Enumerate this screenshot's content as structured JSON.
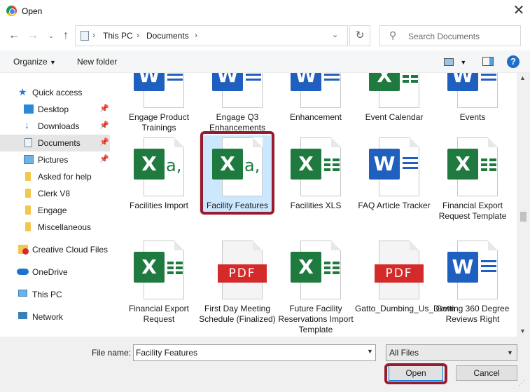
{
  "window": {
    "title": "Open"
  },
  "address": {
    "crumbs": [
      "This PC",
      "Documents"
    ]
  },
  "search": {
    "placeholder": "Search Documents"
  },
  "toolbar": {
    "organize_label": "Organize",
    "new_folder_label": "New folder"
  },
  "sidebar": {
    "items": [
      {
        "label": "Quick access",
        "icon": "star-icon",
        "pinned": false
      },
      {
        "label": "Desktop",
        "icon": "desktop-icon",
        "pinned": true
      },
      {
        "label": "Downloads",
        "icon": "download-icon",
        "pinned": true
      },
      {
        "label": "Documents",
        "icon": "documents-icon",
        "pinned": true,
        "selected": true
      },
      {
        "label": "Pictures",
        "icon": "pictures-icon",
        "pinned": true
      },
      {
        "label": "Asked for help",
        "icon": "folder-icon"
      },
      {
        "label": "Clerk V8",
        "icon": "folder-icon"
      },
      {
        "label": "Engage",
        "icon": "folder-icon"
      },
      {
        "label": "Miscellaneous",
        "icon": "folder-icon"
      },
      {
        "label": "Creative Cloud Files",
        "icon": "creative-cloud-icon"
      },
      {
        "label": "OneDrive",
        "icon": "cloud-icon"
      },
      {
        "label": "This PC",
        "icon": "computer-icon"
      },
      {
        "label": "Network",
        "icon": "network-icon"
      }
    ]
  },
  "files": [
    {
      "name": "Engage Product Trainings",
      "type": "word"
    },
    {
      "name": "Engage Q3 Enhancements",
      "type": "word"
    },
    {
      "name": "Enhancement",
      "type": "word"
    },
    {
      "name": "Event Calendar",
      "type": "excel"
    },
    {
      "name": "Events",
      "type": "word"
    },
    {
      "name": "Facilities Import",
      "type": "csv"
    },
    {
      "name": "Facility Features",
      "type": "csv",
      "selected": true
    },
    {
      "name": "Facilities XLS",
      "type": "excel"
    },
    {
      "name": "FAQ Article Tracker",
      "type": "word"
    },
    {
      "name": "Financial Export Request Template",
      "type": "excel"
    },
    {
      "name": "Financial Export Request",
      "type": "excel"
    },
    {
      "name": "First Day Meeting Schedule (Finalized)",
      "type": "pdf"
    },
    {
      "name": "Future Facility Reservations Import Template",
      "type": "excel"
    },
    {
      "name": "Gatto_Dumbing_Us_Down",
      "type": "pdf"
    },
    {
      "name": "Getting 360 Degree Reviews Right",
      "type": "word"
    }
  ],
  "icons": {
    "word_letter": "W",
    "excel_letter": "X",
    "csv_glyph": "a,",
    "pdf_label": "PDF"
  },
  "bottom": {
    "file_name_label": "File name:",
    "file_name_value": "Facility Features",
    "file_type": "All Files",
    "open_label": "Open",
    "cancel_label": "Cancel"
  },
  "colors": {
    "highlight": "#9b1b2e",
    "selection": "#cce8ff",
    "excel": "#1f7a3f",
    "word": "#1f5fbf",
    "pdf": "#d42a2a"
  }
}
